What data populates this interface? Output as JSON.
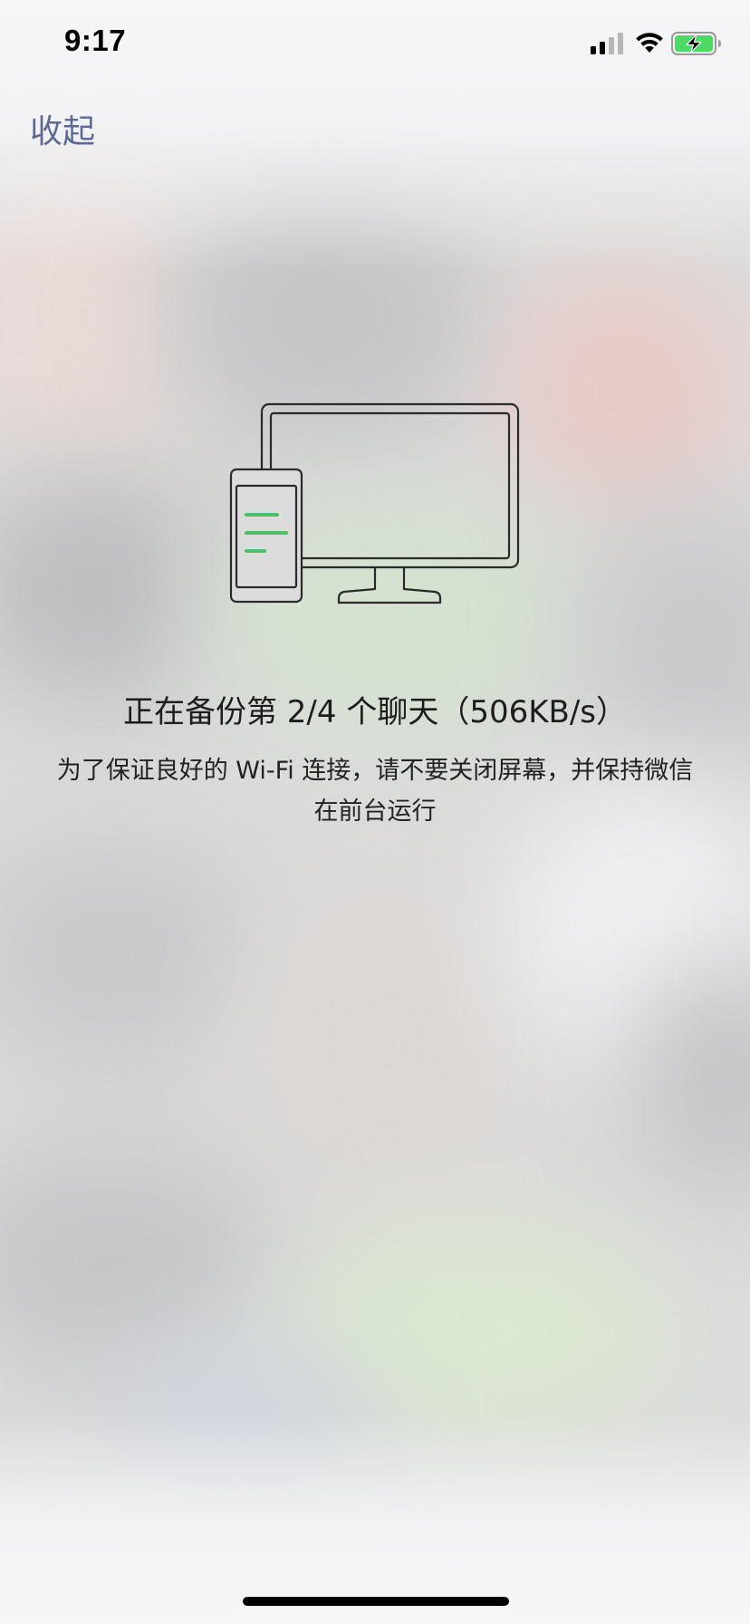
{
  "status_bar": {
    "time": "9:17",
    "icons": [
      "cellular-signal-icon",
      "wifi-icon",
      "battery-charging-icon"
    ]
  },
  "nav": {
    "collapse_label": "收起"
  },
  "backup": {
    "title": "正在备份第 2/4 个聊天（506KB/s）",
    "subtitle": "为了保证良好的 Wi-Fi 连接，请不要关闭屏幕，并保持微信在前台运行"
  },
  "colors": {
    "accent_link": "#5c6a94",
    "illustration_green": "#4cbf67",
    "battery_green": "#4cd964"
  }
}
